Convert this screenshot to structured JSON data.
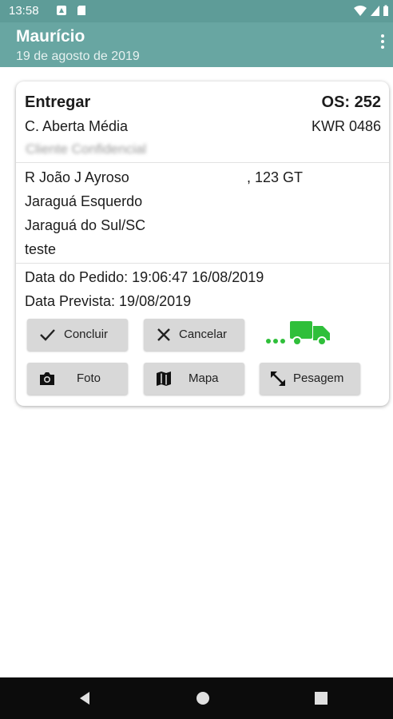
{
  "status_bar": {
    "time": "13:58"
  },
  "app_bar": {
    "title": "Maurício",
    "subtitle": "19 de agosto de 2019"
  },
  "order": {
    "action": "Entregar",
    "os": "OS: 252",
    "vehicle": "C. Aberta Média",
    "plate": "KWR 0486",
    "client_obscured": "Cliente Confidencial",
    "street": "R João J Ayroso",
    "number": ", 123 GT",
    "district": "Jaraguá Esquerdo",
    "city": "Jaraguá do Sul/SC",
    "note": "teste",
    "order_date": "Data do Pedido: 19:06:47 16/08/2019",
    "expected_date": "Data Prevista: 19/08/2019"
  },
  "buttons": {
    "concluir": "Concluir",
    "cancelar": "Cancelar",
    "foto": "Foto",
    "mapa": "Mapa",
    "pesagem": "Pesagem"
  },
  "colors": {
    "status_bar": "#5e9c98",
    "app_bar": "#68a6a2",
    "truck": "#2fbf3a"
  }
}
